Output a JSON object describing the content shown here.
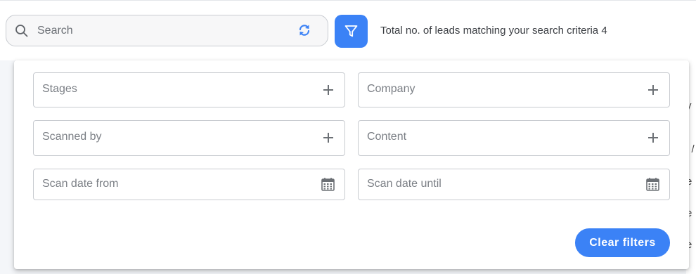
{
  "search": {
    "placeholder": "Search"
  },
  "header": {
    "total_text": "Total no. of leads matching your search criteria 4"
  },
  "filters": {
    "stages": "Stages",
    "company": "Company",
    "scanned_by": "Scanned by",
    "content": "Content",
    "scan_date_from": "Scan date from",
    "scan_date_until": "Scan date until",
    "clear_label": "Clear filters"
  },
  "background_edge": {
    "row_chars": [
      "y",
      "l /",
      "e",
      "e",
      "e"
    ]
  },
  "colors": {
    "accent": "#3b82f6",
    "border": "#c8cbd0",
    "placeholder": "#7b7f85"
  },
  "icons": {
    "search": "search-icon",
    "refresh": "refresh-icon",
    "filter": "filter-icon",
    "add": "plus-icon",
    "calendar": "calendar-icon"
  }
}
